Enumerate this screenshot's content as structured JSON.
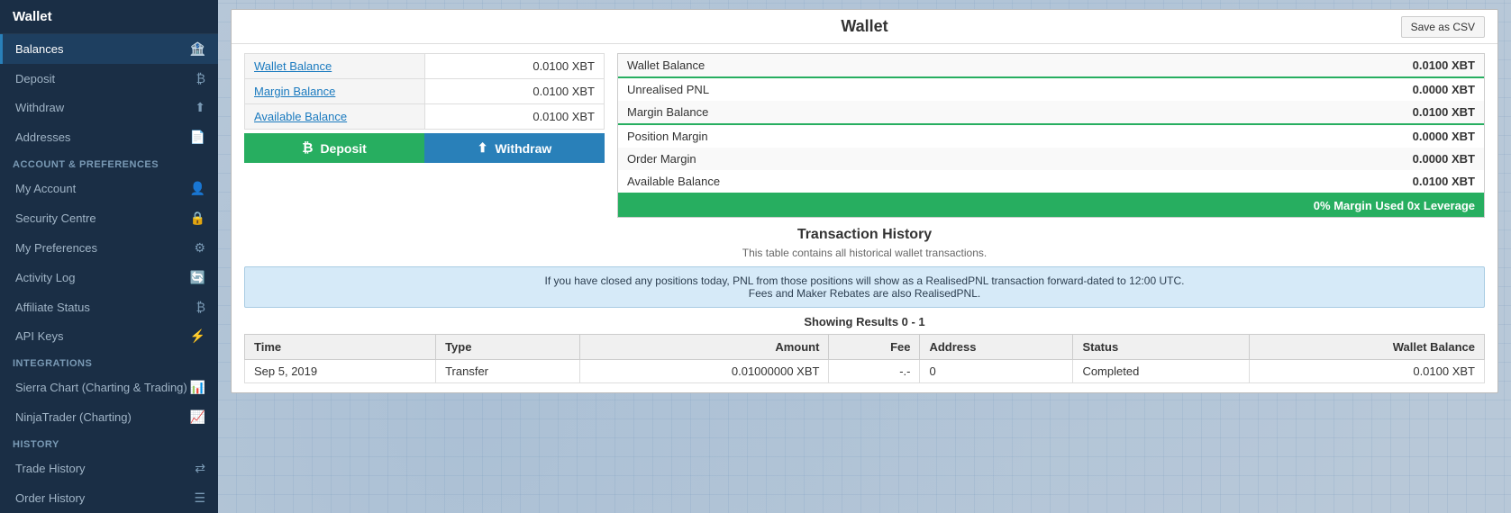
{
  "sidebar": {
    "header": "Wallet",
    "active_item": "Balances",
    "items": [
      {
        "id": "balances",
        "label": "Balances",
        "icon": "🏦",
        "active": true
      },
      {
        "id": "deposit",
        "label": "Deposit",
        "icon": "₿"
      },
      {
        "id": "withdraw",
        "label": "Withdraw",
        "icon": "⬆"
      },
      {
        "id": "addresses",
        "label": "Addresses",
        "icon": "📄"
      }
    ],
    "sections": [
      {
        "id": "account-preferences",
        "label": "Account & Preferences",
        "items": [
          {
            "id": "my-account",
            "label": "My Account",
            "icon": "👤"
          },
          {
            "id": "security-centre",
            "label": "Security Centre",
            "icon": "🔒"
          },
          {
            "id": "my-preferences",
            "label": "My Preferences",
            "icon": "⚙"
          },
          {
            "id": "activity-log",
            "label": "Activity Log",
            "icon": "🔄"
          },
          {
            "id": "affiliate-status",
            "label": "Affiliate Status",
            "icon": "₿"
          },
          {
            "id": "api-keys",
            "label": "API Keys",
            "icon": "⚡"
          }
        ]
      },
      {
        "id": "integrations",
        "label": "Integrations",
        "items": [
          {
            "id": "sierra-chart",
            "label": "Sierra Chart (Charting & Trading)",
            "icon": "📊"
          },
          {
            "id": "ninjatrader",
            "label": "NinjaTrader (Charting)",
            "icon": "📈"
          }
        ]
      },
      {
        "id": "history",
        "label": "History",
        "items": [
          {
            "id": "trade-history",
            "label": "Trade History",
            "icon": "⇄"
          },
          {
            "id": "order-history",
            "label": "Order History",
            "icon": "☰"
          }
        ]
      }
    ]
  },
  "wallet": {
    "title": "Wallet",
    "save_csv_label": "Save as CSV",
    "balance_left": {
      "rows": [
        {
          "label": "Wallet Balance",
          "value": "0.0100 XBT"
        },
        {
          "label": "Margin Balance",
          "value": "0.0100 XBT"
        },
        {
          "label": "Available Balance",
          "value": "0.0100 XBT"
        }
      ],
      "deposit_label": "Deposit",
      "withdraw_label": "Withdraw"
    },
    "balance_right": {
      "rows": [
        {
          "label": "Wallet Balance",
          "value": "0.0100 XBT",
          "green_border": true
        },
        {
          "label": "Unrealised PNL",
          "value": "0.0000 XBT"
        },
        {
          "label": "Margin Balance",
          "value": "0.0100 XBT",
          "green_border": true
        },
        {
          "label": "Position Margin",
          "value": "0.0000 XBT"
        },
        {
          "label": "Order Margin",
          "value": "0.0000 XBT"
        },
        {
          "label": "Available Balance",
          "value": "0.0100 XBT",
          "green_border": true
        }
      ],
      "margin_row": "0% Margin Used  0x Leverage"
    },
    "transaction_history": {
      "title": "Transaction History",
      "subtitle": "This table contains all historical wallet transactions.",
      "info_message": "If you have closed any positions today, PNL from those positions will show as a RealisedPNL transaction forward-dated to 12:00 UTC.\nFees and Maker Rebates are also RealisedPNL.",
      "results_label": "Showing Results 0 - 1",
      "columns": [
        "Time",
        "Type",
        "Amount",
        "Fee",
        "Address",
        "Status",
        "Wallet Balance"
      ],
      "rows": [
        {
          "time": "Sep 5, 2019",
          "type": "Transfer",
          "amount": "0.01000000 XBT",
          "fee": "-.-",
          "address": "0",
          "status": "Completed",
          "wallet_balance": "0.0100 XBT"
        }
      ]
    }
  }
}
